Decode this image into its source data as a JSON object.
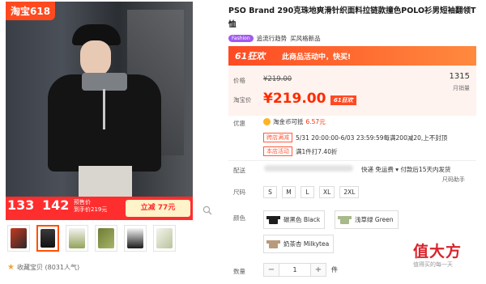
{
  "gallery": {
    "corner_logo": "淘宝618",
    "banner_price1": "133",
    "banner_price2": "142",
    "banner_small1": "预售价",
    "banner_small2": "到手价219元",
    "banner_coupon": "立减 77元",
    "thumbs": [
      {
        "name": "thumb-1",
        "color": "#8b2c1f"
      },
      {
        "name": "thumb-2",
        "color": "#1d1d1d"
      },
      {
        "name": "thumb-3",
        "color": "#93a35a"
      },
      {
        "name": "thumb-4",
        "color": "#8a9a4a"
      },
      {
        "name": "thumb-5",
        "color": "#2a2a2a"
      },
      {
        "name": "thumb-6",
        "color": "#b9c49b"
      }
    ],
    "favorite_label": "收藏宝贝 (8031人气)"
  },
  "product": {
    "title": "PSO Brand 290克珠地爽滑针织面料拉链款撞色POLO衫男短袖翻领T恤",
    "fashion_badge": "Fashion",
    "tag1": "追流行趋势",
    "tag2": "买风格新品",
    "promo_logo": "61狂欢",
    "promo_msg": "此商品活动中，快买!",
    "price_label": "价格",
    "orig_price": "¥219.00",
    "sold_count": "1315",
    "sold_label": "月销量",
    "taobao_label": "淘宝价",
    "cur_price": "¥219.00",
    "badge618": "61狂欢",
    "offers_label": "优惠",
    "coins_text": "淘金币可抵",
    "coins_value": "6.57元",
    "promo_tag1": "跨店满减",
    "promo_text1": "5/31 20:00:00-6/03 23:59:59每满200减20,上不封顶",
    "promo_tag2": "本店活动",
    "promo_text2": "满1件打7.40折",
    "ship_label": "配送",
    "ship_info": "快递 免运费  ▾  付款后15天内发货",
    "ship_sub": "尺码助手",
    "size_label": "尺码",
    "sizes": [
      "S",
      "M",
      "L",
      "XL",
      "2XL"
    ],
    "color_label": "颜色",
    "colors": [
      {
        "label": "碳黑色 Black",
        "hex": "#1e1e1e"
      },
      {
        "label": "浅草绿 Green",
        "hex": "#a9b98a"
      },
      {
        "label": "奶茶杏 Milkytea",
        "hex": "#b89a7c"
      }
    ],
    "qty_label": "数量",
    "qty_value": "1",
    "qty_unit": "件"
  },
  "watermark": {
    "main": "值大方",
    "sub": "值得买的每一天"
  },
  "accent": "#ff5000"
}
